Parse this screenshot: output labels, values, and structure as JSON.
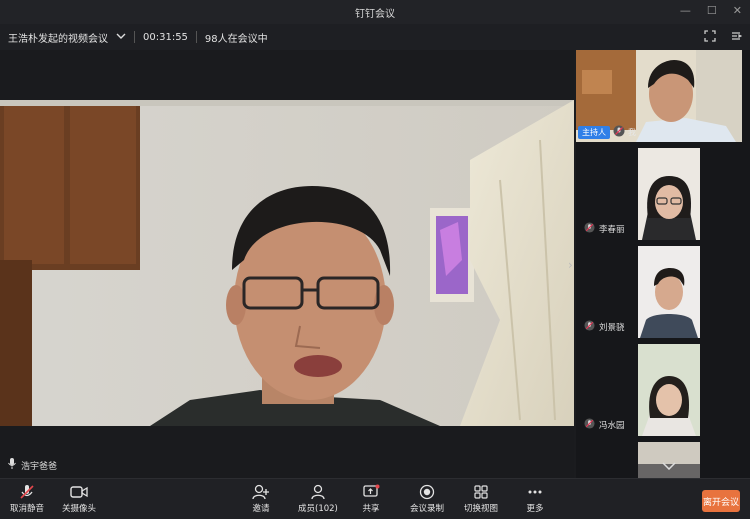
{
  "app": {
    "title": "钉钉会议"
  },
  "meeting": {
    "name": "王浩朴发起的视频会议",
    "duration": "00:31:55",
    "attendance": "98人在会议中"
  },
  "main_video": {
    "speaker": "浩宇爸爸"
  },
  "host_tile": {
    "role_tag": "主持人",
    "name": "我"
  },
  "participants": [
    {
      "name": "李春丽"
    },
    {
      "name": "刘景骁"
    },
    {
      "name": "冯水园"
    }
  ],
  "toolbar": {
    "mute_label": "取消静音",
    "camera_label": "关摄像头",
    "invite_label": "邀请",
    "members_label": "成员(102)",
    "share_label": "共享",
    "record_label": "会议录制",
    "switch_view_label": "切换视图",
    "more_label": "更多",
    "leave_label": "离开会议"
  },
  "colors": {
    "accent": "#2f7fe8",
    "leave": "#e8733e",
    "background": "#1b1c1f"
  }
}
